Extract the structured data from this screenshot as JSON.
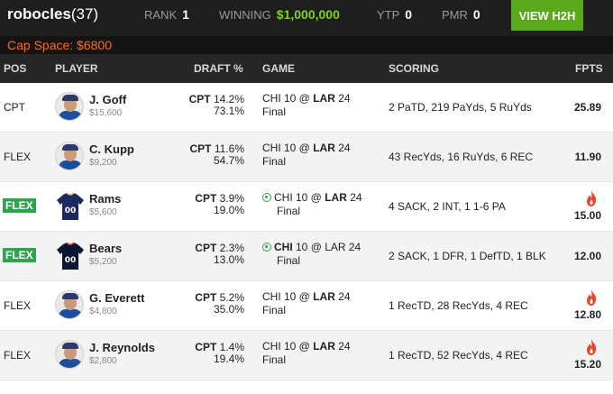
{
  "header": {
    "username": "robocles",
    "user_count": "(37)",
    "rank_label": "RANK",
    "rank_value": "1",
    "winning_label": "WINNING",
    "winning_value": "$1,000,000",
    "ytp_label": "YTP",
    "ytp_value": "0",
    "pmr_label": "PMR",
    "pmr_value": "0",
    "h2h_button": "VIEW H2H"
  },
  "cap_space": "Cap Space: $6800",
  "columns": {
    "pos": "POS",
    "player": "PLAYER",
    "draft": "DRAFT %",
    "game": "GAME",
    "scoring": "SCORING",
    "fpts": "FPTS"
  },
  "colors": {
    "accent_green": "#5aa81c",
    "cap_orange": "#ff6a1a",
    "flex_badge": "#2ea44f",
    "fire": "#e8452c"
  },
  "rows": [
    {
      "pos": "CPT",
      "pos_badge": false,
      "player": "J. Goff",
      "salary": "$15,600",
      "draft_cpt_label": "CPT",
      "draft_cpt": "14.2%",
      "draft_flex": "73.1%",
      "game_line_pre": "CHI 10 @ ",
      "game_line_bold": "LAR",
      "game_line_post": " 24",
      "game_status": "Final",
      "scoring": "2 PaTD, 219 PaYds, 5 RuYds",
      "fpts": "25.89",
      "hot": false,
      "icon": "player-avatar"
    },
    {
      "pos": "FLEX",
      "pos_badge": false,
      "player": "C. Kupp",
      "salary": "$9,200",
      "draft_cpt_label": "CPT",
      "draft_cpt": "11.6%",
      "draft_flex": "54.7%",
      "game_line_pre": "CHI 10 @ ",
      "game_line_bold": "LAR",
      "game_line_post": " 24",
      "game_status": "Final",
      "scoring": "43 RecYds, 16 RuYds, 6 REC",
      "fpts": "11.90",
      "hot": false,
      "icon": "player-avatar"
    },
    {
      "pos": "FLEX",
      "pos_badge": true,
      "player": "Rams",
      "salary": "$5,600",
      "draft_cpt_label": "CPT",
      "draft_cpt": "3.9%",
      "draft_flex": "19.0%",
      "game_line_pre": "CHI 10 @ ",
      "game_line_bold": "LAR",
      "game_line_post": " 24",
      "game_status": "Final",
      "scoring": "4 SACK, 2 INT, 1 1-6 PA",
      "fpts": "15.00",
      "hot": true,
      "icon": "rams-jersey-icon"
    },
    {
      "pos": "FLEX",
      "pos_badge": true,
      "player": "Bears",
      "salary": "$5,200",
      "draft_cpt_label": "CPT",
      "draft_cpt": "2.3%",
      "draft_flex": "13.0%",
      "game_line_pre": "",
      "game_line_bold": "CHI",
      "game_line_post": " 10 @ LAR 24",
      "game_status": "Final",
      "scoring": "2 SACK, 1 DFR, 1 DefTD, 1 BLK",
      "fpts": "12.00",
      "hot": false,
      "icon": "bears-jersey-icon"
    },
    {
      "pos": "FLEX",
      "pos_badge": false,
      "player": "G. Everett",
      "salary": "$4,800",
      "draft_cpt_label": "CPT",
      "draft_cpt": "5.2%",
      "draft_flex": "35.0%",
      "game_line_pre": "CHI 10 @ ",
      "game_line_bold": "LAR",
      "game_line_post": " 24",
      "game_status": "Final",
      "scoring": "1 RecTD, 28 RecYds, 4 REC",
      "fpts": "12.80",
      "hot": true,
      "icon": "player-avatar"
    },
    {
      "pos": "FLEX",
      "pos_badge": false,
      "player": "J. Reynolds",
      "salary": "$2,800",
      "draft_cpt_label": "CPT",
      "draft_cpt": "1.4%",
      "draft_flex": "19.4%",
      "game_line_pre": "CHI 10 @ ",
      "game_line_bold": "LAR",
      "game_line_post": " 24",
      "game_status": "Final",
      "scoring": "1 RecTD, 52 RecYds, 4 REC",
      "fpts": "15.20",
      "hot": true,
      "icon": "player-avatar"
    }
  ]
}
